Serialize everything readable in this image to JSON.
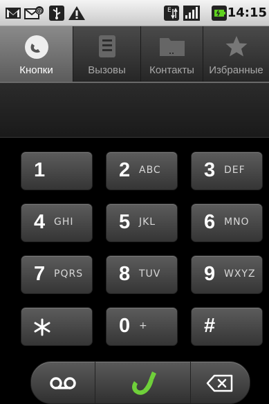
{
  "status_bar": {
    "time": "14:15",
    "icons": [
      "gmail-icon",
      "email-icon",
      "usb-icon",
      "warning-icon",
      "data-network-icon",
      "signal-icon",
      "battery-icon"
    ]
  },
  "tabs": [
    {
      "label": "Кнопки",
      "icon": "phone-handset-icon",
      "active": true
    },
    {
      "label": "Вызовы",
      "icon": "call-log-icon",
      "active": false
    },
    {
      "label": "Контакты",
      "icon": "contacts-icon",
      "active": false
    },
    {
      "label": "Избранные",
      "icon": "star-icon",
      "active": false
    }
  ],
  "display": {
    "number": ""
  },
  "keypad": [
    {
      "digit": "1",
      "letters": ""
    },
    {
      "digit": "2",
      "letters": "ABC"
    },
    {
      "digit": "3",
      "letters": "DEF"
    },
    {
      "digit": "4",
      "letters": "GHI"
    },
    {
      "digit": "5",
      "letters": "JKL"
    },
    {
      "digit": "6",
      "letters": "MNO"
    },
    {
      "digit": "7",
      "letters": "PQRS"
    },
    {
      "digit": "8",
      "letters": "TUV"
    },
    {
      "digit": "9",
      "letters": "WXYZ"
    },
    {
      "digit": "*",
      "letters": ""
    },
    {
      "digit": "0",
      "letters": "+"
    },
    {
      "digit": "#",
      "letters": ""
    }
  ],
  "actions": [
    "voicemail-icon",
    "call-icon",
    "backspace-icon"
  ],
  "colors": {
    "call_green": "#6fd03a",
    "active_tab": "#7a7a7a"
  }
}
